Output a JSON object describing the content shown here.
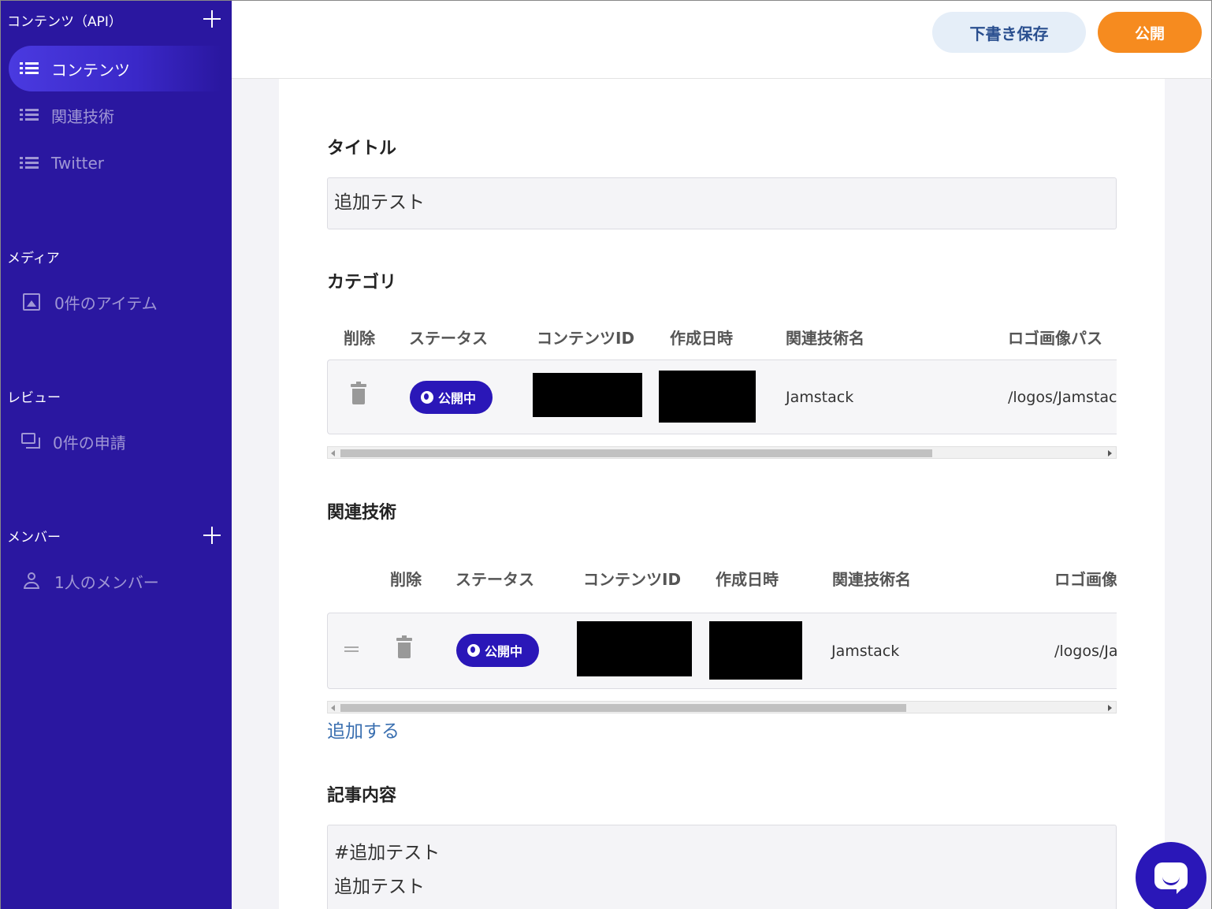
{
  "sidebar": {
    "content_header": "コンテンツ（API）",
    "content_items": [
      {
        "label": "コンテンツ",
        "active": true
      },
      {
        "label": "関連技術",
        "active": false
      },
      {
        "label": "Twitter",
        "active": false
      }
    ],
    "media_header": "メディア",
    "media_item": "0件のアイテム",
    "review_header": "レビュー",
    "review_item": "0件の申請",
    "member_header": "メンバー",
    "member_item": "1人のメンバー"
  },
  "toolbar": {
    "draft_label": "下書き保存",
    "publish_label": "公開"
  },
  "form": {
    "title_label": "タイトル",
    "title_value": "追加テスト",
    "category_label": "カテゴリ",
    "category_table": {
      "headers": [
        "削除",
        "ステータス",
        "コンテンツID",
        "作成日時",
        "関連技術名",
        "ロゴ画像パス"
      ],
      "row": {
        "status": "公開中",
        "name": "Jamstack",
        "logo_path": "/logos/Jamstac"
      }
    },
    "related_label": "関連技術",
    "related_table": {
      "headers": [
        "削除",
        "ステータス",
        "コンテンツID",
        "作成日時",
        "関連技術名",
        "ロゴ画像"
      ],
      "row": {
        "status": "公開中",
        "name": "Jamstack",
        "logo_path": "/logos/Ja"
      }
    },
    "add_label": "追加する",
    "body_label": "記事内容",
    "body_lines": [
      "#追加テスト",
      "追加テスト"
    ]
  },
  "colors": {
    "sidebar_bg": "#2a17a0",
    "publish_btn": "#f68b1f",
    "draft_btn": "#e5eef8",
    "badge": "#2a17b8"
  }
}
